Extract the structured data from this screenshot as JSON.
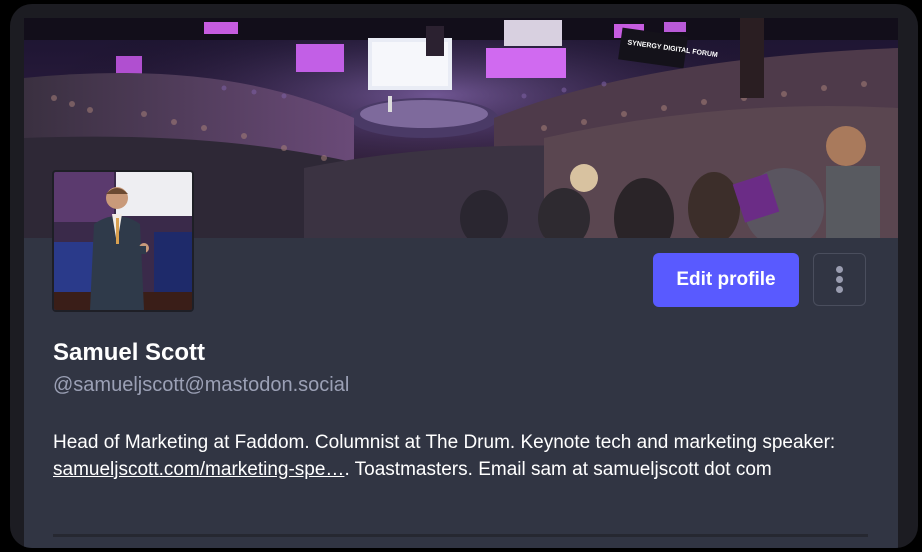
{
  "profile": {
    "display_name": "Samuel Scott",
    "handle": "@samueljscott@mastodon.social",
    "bio_part1": "Head of Marketing at Faddom. Columnist at The Drum. Keynote tech and marketing speaker: ",
    "bio_link": "samueljscott.com/marketing-spe…",
    "bio_part2": ". Toastmasters. Email sam at samueljscott dot com"
  },
  "actions": {
    "edit_label": "Edit profile",
    "more_icon": "vertical-ellipsis-icon"
  },
  "banner": {
    "sign_text": "SYNERGY DIGITAL FORUM"
  },
  "colors": {
    "accent": "#595aff",
    "card_bg": "#313543",
    "handle_text": "#9ba0b5",
    "outer_bg": "#1c1c22"
  }
}
